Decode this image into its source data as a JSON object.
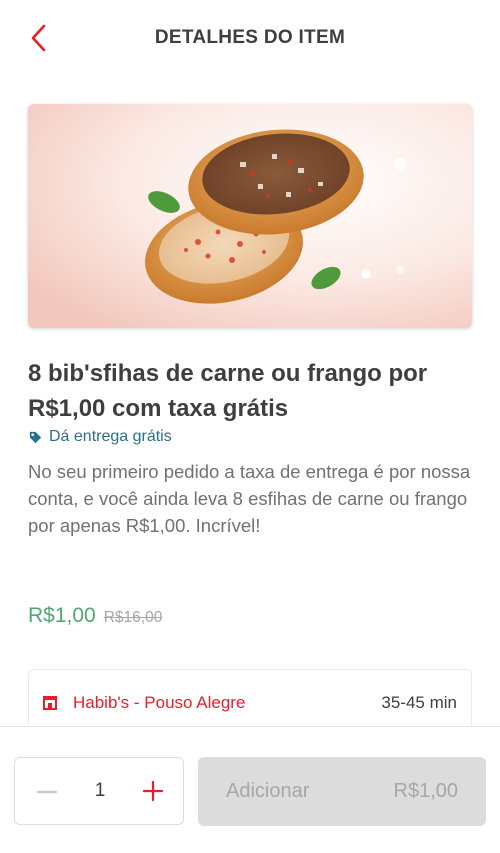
{
  "header": {
    "title": "DETALHES DO ITEM",
    "back_icon": "chevron-left-icon"
  },
  "item": {
    "title": "8 bib'sfihas de carne ou frango por R$1,00 com taxa grátis",
    "tag": "Dá entrega grátis",
    "tag_icon": "tag-icon",
    "description": "No seu primeiro pedido a taxa de entrega é por nossa conta, e você ainda leva 8 esfihas de carne ou frango por apenas R$1,00. Incrível!",
    "price": "R$1,00",
    "original_price": "R$16,00"
  },
  "store": {
    "icon": "store-icon",
    "name": "Habib's - Pouso Alegre",
    "delivery_time": "35-45 min"
  },
  "footer": {
    "quantity": "1",
    "minus_icon": "minus-icon",
    "plus_icon": "plus-icon",
    "add_label": "Adicionar",
    "add_price": "R$1,00"
  },
  "colors": {
    "accent": "#ea1d2c",
    "price_green": "#50a773",
    "tag_blue": "#2b6f8a",
    "disabled_bg": "#dcdcdc"
  }
}
